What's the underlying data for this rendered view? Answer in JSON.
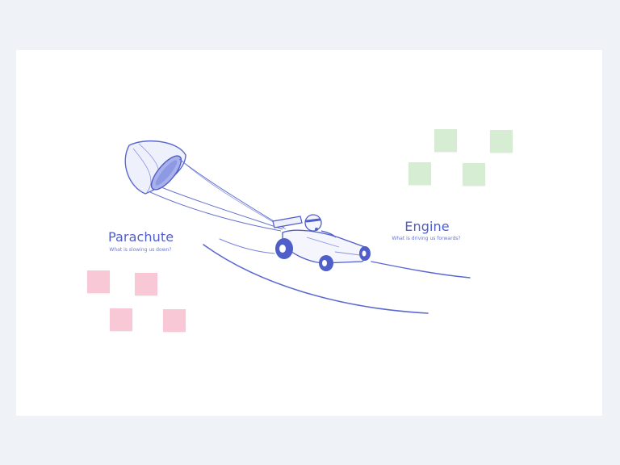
{
  "colors": {
    "background": "#eff2f6",
    "board": "#ffffff",
    "accent": "#4f5ec9",
    "sticky_pink": "#f8c8d6",
    "sticky_green": "#d6edd4"
  },
  "board": {
    "sections": {
      "parachute": {
        "title": "Parachute",
        "subtitle": "What is slowing us down?"
      },
      "engine": {
        "title": "Engine",
        "subtitle": "What is driving us forwards?"
      }
    },
    "illustration": {
      "icons": [
        "parachute-icon",
        "race-car-icon",
        "driver-icon"
      ]
    }
  }
}
